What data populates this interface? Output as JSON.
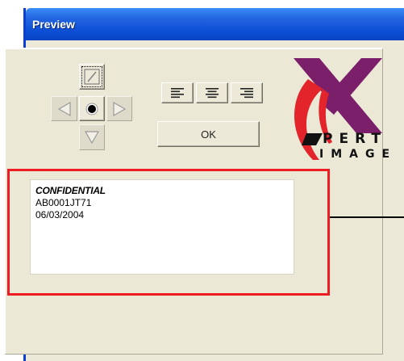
{
  "window": {
    "title": "Preview"
  },
  "controls": {
    "up_button_icon": "slash-box-icon",
    "left_button_icon": "triangle-left-icon",
    "center_button_icon": "radio-dot-icon",
    "right_button_icon": "triangle-right-icon",
    "down_button_icon": "triangle-down-icon",
    "align_buttons": [
      {
        "icon": "align-left-icon"
      },
      {
        "icon": "align-center-icon"
      },
      {
        "icon": "align-right-icon"
      }
    ],
    "ok_label": "OK"
  },
  "logo": {
    "lines": [
      "PERT",
      "IMAGE"
    ],
    "letter_x_color": "#7b1f6a",
    "swoosh_color": "#e3242b"
  },
  "preview": {
    "title": "CONFIDENTIAL",
    "line1": "AB0001JT71",
    "line2": "06/03/2004"
  },
  "annotation": {
    "highlight_color": "#ee1d23"
  }
}
